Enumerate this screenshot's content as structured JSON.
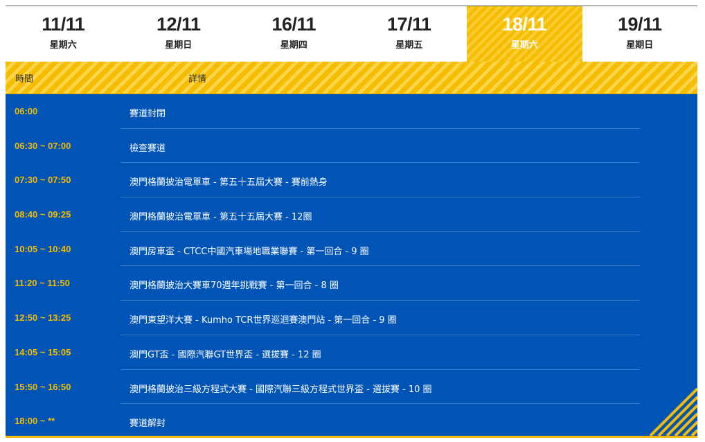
{
  "tabs": [
    {
      "date": "11/11",
      "weekday": "星期六"
    },
    {
      "date": "12/11",
      "weekday": "星期日"
    },
    {
      "date": "16/11",
      "weekday": "星期四"
    },
    {
      "date": "17/11",
      "weekday": "星期五"
    },
    {
      "date": "18/11",
      "weekday": "星期六"
    },
    {
      "date": "19/11",
      "weekday": "星期日"
    }
  ],
  "active_tab": "18/11",
  "header": {
    "time_label": "時間",
    "detail_label": "詳情"
  },
  "schedule": [
    {
      "time": "06:00",
      "event": "賽道封閉"
    },
    {
      "time": "06:30 ~ 07:00",
      "event": "檢查賽道"
    },
    {
      "time": "07:30 ~ 07:50",
      "event": "澳門格蘭披治電單車 - 第五十五屆大賽 - 賽前熱身"
    },
    {
      "time": "08:40 ~ 09:25",
      "event": "澳門格蘭披治電單車 - 第五十五屆大賽 - 12圈"
    },
    {
      "time": "10:05 ~ 10:40",
      "event": "澳門房車盃 - CTCC中國汽車場地職業聯賽 - 第一回合 - 9 圈"
    },
    {
      "time": "11:20 ~ 11:50",
      "event": "澳門格蘭披治大賽車70週年挑戰賽 - 第一回合 - 8 圈"
    },
    {
      "time": "12:50 ~ 13:25",
      "event": "澳門東望洋大賽 - Kumho TCR世界巡迴賽澳門站 - 第一回合 - 9 圈"
    },
    {
      "time": "14:05 ~ 15:05",
      "event": "澳門GT盃 - 國際汽聯GT世界盃 - 選拔賽 - 12 圈"
    },
    {
      "time": "15:50 ~ 16:50",
      "event": "澳門格蘭披治三級方程式大賽 - 國際汽聯三級方程式世界盃 - 選拔賽 - 10 圈"
    },
    {
      "time": "18:00 ~ **",
      "event": "賽道解封"
    }
  ],
  "colors": {
    "accent": "#f6bd00",
    "panel": "#0054b6",
    "time_text": "#f6bd00",
    "event_text": "#ffffff"
  }
}
